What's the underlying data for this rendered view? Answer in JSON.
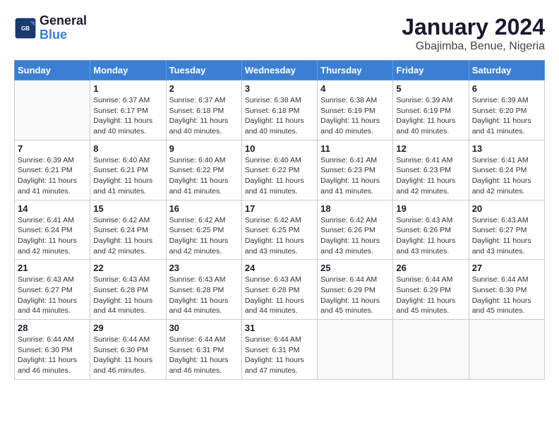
{
  "header": {
    "logo_general": "General",
    "logo_blue": "Blue",
    "month_year": "January 2024",
    "location": "Gbajimba, Benue, Nigeria"
  },
  "weekdays": [
    "Sunday",
    "Monday",
    "Tuesday",
    "Wednesday",
    "Thursday",
    "Friday",
    "Saturday"
  ],
  "weeks": [
    [
      {
        "day": "",
        "info": ""
      },
      {
        "day": "1",
        "info": "Sunrise: 6:37 AM\nSunset: 6:17 PM\nDaylight: 11 hours\nand 40 minutes."
      },
      {
        "day": "2",
        "info": "Sunrise: 6:37 AM\nSunset: 6:18 PM\nDaylight: 11 hours\nand 40 minutes."
      },
      {
        "day": "3",
        "info": "Sunrise: 6:38 AM\nSunset: 6:18 PM\nDaylight: 11 hours\nand 40 minutes."
      },
      {
        "day": "4",
        "info": "Sunrise: 6:38 AM\nSunset: 6:19 PM\nDaylight: 11 hours\nand 40 minutes."
      },
      {
        "day": "5",
        "info": "Sunrise: 6:39 AM\nSunset: 6:19 PM\nDaylight: 11 hours\nand 40 minutes."
      },
      {
        "day": "6",
        "info": "Sunrise: 6:39 AM\nSunset: 6:20 PM\nDaylight: 11 hours\nand 41 minutes."
      }
    ],
    [
      {
        "day": "7",
        "info": "Sunrise: 6:39 AM\nSunset: 6:21 PM\nDaylight: 11 hours\nand 41 minutes."
      },
      {
        "day": "8",
        "info": "Sunrise: 6:40 AM\nSunset: 6:21 PM\nDaylight: 11 hours\nand 41 minutes."
      },
      {
        "day": "9",
        "info": "Sunrise: 6:40 AM\nSunset: 6:22 PM\nDaylight: 11 hours\nand 41 minutes."
      },
      {
        "day": "10",
        "info": "Sunrise: 6:40 AM\nSunset: 6:22 PM\nDaylight: 11 hours\nand 41 minutes."
      },
      {
        "day": "11",
        "info": "Sunrise: 6:41 AM\nSunset: 6:23 PM\nDaylight: 11 hours\nand 41 minutes."
      },
      {
        "day": "12",
        "info": "Sunrise: 6:41 AM\nSunset: 6:23 PM\nDaylight: 11 hours\nand 42 minutes."
      },
      {
        "day": "13",
        "info": "Sunrise: 6:41 AM\nSunset: 6:24 PM\nDaylight: 11 hours\nand 42 minutes."
      }
    ],
    [
      {
        "day": "14",
        "info": "Sunrise: 6:41 AM\nSunset: 6:24 PM\nDaylight: 11 hours\nand 42 minutes."
      },
      {
        "day": "15",
        "info": "Sunrise: 6:42 AM\nSunset: 6:24 PM\nDaylight: 11 hours\nand 42 minutes."
      },
      {
        "day": "16",
        "info": "Sunrise: 6:42 AM\nSunset: 6:25 PM\nDaylight: 11 hours\nand 42 minutes."
      },
      {
        "day": "17",
        "info": "Sunrise: 6:42 AM\nSunset: 6:25 PM\nDaylight: 11 hours\nand 43 minutes."
      },
      {
        "day": "18",
        "info": "Sunrise: 6:42 AM\nSunset: 6:26 PM\nDaylight: 11 hours\nand 43 minutes."
      },
      {
        "day": "19",
        "info": "Sunrise: 6:43 AM\nSunset: 6:26 PM\nDaylight: 11 hours\nand 43 minutes."
      },
      {
        "day": "20",
        "info": "Sunrise: 6:43 AM\nSunset: 6:27 PM\nDaylight: 11 hours\nand 43 minutes."
      }
    ],
    [
      {
        "day": "21",
        "info": "Sunrise: 6:43 AM\nSunset: 6:27 PM\nDaylight: 11 hours\nand 44 minutes."
      },
      {
        "day": "22",
        "info": "Sunrise: 6:43 AM\nSunset: 6:28 PM\nDaylight: 11 hours\nand 44 minutes."
      },
      {
        "day": "23",
        "info": "Sunrise: 6:43 AM\nSunset: 6:28 PM\nDaylight: 11 hours\nand 44 minutes."
      },
      {
        "day": "24",
        "info": "Sunrise: 6:43 AM\nSunset: 6:28 PM\nDaylight: 11 hours\nand 44 minutes."
      },
      {
        "day": "25",
        "info": "Sunrise: 6:44 AM\nSunset: 6:29 PM\nDaylight: 11 hours\nand 45 minutes."
      },
      {
        "day": "26",
        "info": "Sunrise: 6:44 AM\nSunset: 6:29 PM\nDaylight: 11 hours\nand 45 minutes."
      },
      {
        "day": "27",
        "info": "Sunrise: 6:44 AM\nSunset: 6:30 PM\nDaylight: 11 hours\nand 45 minutes."
      }
    ],
    [
      {
        "day": "28",
        "info": "Sunrise: 6:44 AM\nSunset: 6:30 PM\nDaylight: 11 hours\nand 46 minutes."
      },
      {
        "day": "29",
        "info": "Sunrise: 6:44 AM\nSunset: 6:30 PM\nDaylight: 11 hours\nand 46 minutes."
      },
      {
        "day": "30",
        "info": "Sunrise: 6:44 AM\nSunset: 6:31 PM\nDaylight: 11 hours\nand 46 minutes."
      },
      {
        "day": "31",
        "info": "Sunrise: 6:44 AM\nSunset: 6:31 PM\nDaylight: 11 hours\nand 47 minutes."
      },
      {
        "day": "",
        "info": ""
      },
      {
        "day": "",
        "info": ""
      },
      {
        "day": "",
        "info": ""
      }
    ]
  ]
}
